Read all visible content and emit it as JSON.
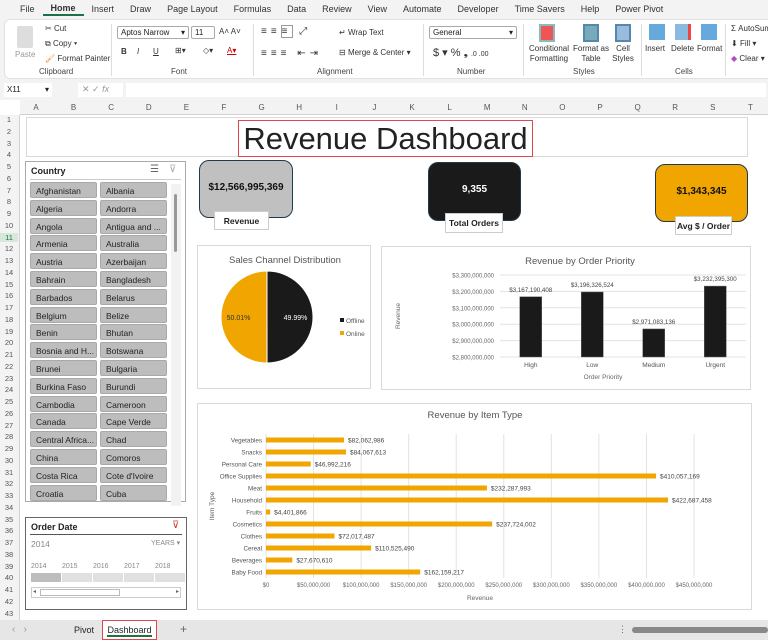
{
  "menu": [
    "File",
    "Home",
    "Insert",
    "Draw",
    "Page Layout",
    "Formulas",
    "Data",
    "Review",
    "View",
    "Automate",
    "Developer",
    "Time Savers",
    "Help",
    "Power Pivot"
  ],
  "ribbon": {
    "clipboard": {
      "paste": "Paste",
      "cut": "Cut",
      "copy": "Copy",
      "format_painter": "Format Painter",
      "label": "Clipboard"
    },
    "font": {
      "name": "Aptos Narrow",
      "size": "11",
      "label": "Font",
      "bold": "B",
      "italic": "I",
      "underline": "U"
    },
    "alignment": {
      "wrap": "Wrap Text",
      "merge": "Merge & Center",
      "label": "Alignment"
    },
    "number": {
      "format": "General",
      "label": "Number"
    },
    "styles": {
      "conditional": "Conditional Formatting",
      "format_table": "Format as Table",
      "cell_styles": "Cell Styles",
      "label": "Styles"
    },
    "cells": {
      "insert": "Insert",
      "delete": "Delete",
      "format": "Format",
      "label": "Cells"
    },
    "editing": {
      "autosum": "AutoSum",
      "fill": "Fill",
      "clear": "Clear"
    }
  },
  "formula_bar": {
    "name_box": "X11",
    "fx": "fx",
    "value": ""
  },
  "columns": [
    "A",
    "B",
    "C",
    "D",
    "E",
    "F",
    "G",
    "H",
    "I",
    "J",
    "K",
    "L",
    "M",
    "N",
    "O",
    "P",
    "Q",
    "R",
    "S",
    "T"
  ],
  "title": "Revenue Dashboard",
  "kpis": [
    {
      "value": "$12,566,995,369",
      "label": "Revenue",
      "color": "#c0c0c0"
    },
    {
      "value": "9,355",
      "label": "Total Orders",
      "color": "#1a1a1a"
    },
    {
      "value": "$1,343,345",
      "label": "Avg $ / Order",
      "color": "#f0a500"
    }
  ],
  "country_slicer": {
    "title": "Country",
    "items": [
      "Afghanistan",
      "Albania",
      "Algeria",
      "Andorra",
      "Angola",
      "Antigua and ...",
      "Armenia",
      "Australia",
      "Austria",
      "Azerbaijan",
      "Bahrain",
      "Bangladesh",
      "Barbados",
      "Belarus",
      "Belgium",
      "Belize",
      "Benin",
      "Bhutan",
      "Bosnia and H...",
      "Botswana",
      "Brunei",
      "Bulgaria",
      "Burkina Faso",
      "Burundi",
      "Cambodia",
      "Cameroon",
      "Canada",
      "Cape Verde",
      "Central Africa...",
      "Chad",
      "China",
      "Comoros",
      "Costa Rica",
      "Cote d'Ivoire",
      "Croatia",
      "Cuba"
    ]
  },
  "timeline": {
    "title": "Order Date",
    "selected": "2014",
    "level": "YEARS",
    "years": [
      "2014",
      "2015",
      "2016",
      "2017",
      "2018"
    ]
  },
  "sheets": {
    "tabs": [
      "Pivot",
      "Dashboard"
    ],
    "active": "Dashboard"
  },
  "chart_data": [
    {
      "type": "pie",
      "title": "Sales Channel Distribution",
      "labels": [
        "Offline",
        "Online"
      ],
      "values": [
        49.99,
        50.01
      ],
      "value_labels": [
        "49.99%",
        "50.01%"
      ],
      "colors": [
        "#1a1a1a",
        "#f0a500"
      ],
      "legend": "right"
    },
    {
      "type": "bar",
      "title": "Revenue by Order Priority",
      "xlabel": "Order Priority",
      "ylabel": "Revenue",
      "categories": [
        "High",
        "Low",
        "Medium",
        "Urgent"
      ],
      "values": [
        3167190408,
        3196326524,
        2971083136,
        3232395300
      ],
      "value_labels": [
        "$3,167,190,408",
        "$3,196,326,524",
        "$2,971,083,136",
        "$3,232,395,300"
      ],
      "ylim": [
        2800000000,
        3300000000
      ],
      "yticks": [
        "$2,800,000,000",
        "$2,900,000,000",
        "$3,000,000,000",
        "$3,100,000,000",
        "$3,200,000,000",
        "$3,300,000,000"
      ],
      "color": "#1a1a1a",
      "grid": true
    },
    {
      "type": "bar",
      "orientation": "horizontal",
      "title": "Revenue by Item Type",
      "xlabel": "Revenue",
      "ylabel": "Item Type",
      "categories": [
        "Vegetables",
        "Snacks",
        "Personal Care",
        "Office Supplies",
        "Meat",
        "Household",
        "Fruits",
        "Cosmetics",
        "Clothes",
        "Cereal",
        "Beverages",
        "Baby Food"
      ],
      "values": [
        82062986,
        84067613,
        46992216,
        410057169,
        232287993,
        422687458,
        4401866,
        237724002,
        72017487,
        110525490,
        27670610,
        162159217
      ],
      "value_labels": [
        "$82,062,986",
        "$84,067,613",
        "$46,992,216",
        "$410,057,169",
        "$232,287,993",
        "$422,687,458",
        "$4,401,866",
        "$237,724,002",
        "$72,017,487",
        "$110,525,490",
        "$27,670,610",
        "$162,159,217"
      ],
      "xlim": [
        0,
        450000000
      ],
      "xticks": [
        "$0",
        "$50,000,000",
        "$100,000,000",
        "$150,000,000",
        "$200,000,000",
        "$250,000,000",
        "$300,000,000",
        "$350,000,000",
        "$400,000,000",
        "$450,000,000"
      ],
      "color": "#f0a500",
      "grid": true
    }
  ]
}
